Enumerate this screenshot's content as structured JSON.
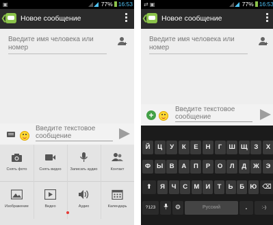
{
  "status": {
    "battery": "77%",
    "time": "16:53"
  },
  "actionbar": {
    "title": "Новое сообщение"
  },
  "recipient": {
    "placeholder": "Введите имя человека или номер"
  },
  "compose": {
    "placeholder": "Введите текстовое сообщение"
  },
  "attachments": [
    {
      "label": "Снять фото",
      "icon": "camera-icon"
    },
    {
      "label": "Снять видео",
      "icon": "video-camera-icon"
    },
    {
      "label": "Записать аудио",
      "icon": "microphone-icon"
    },
    {
      "label": "Контакт",
      "icon": "contact-icon"
    },
    {
      "label": "Изображение",
      "icon": "image-icon"
    },
    {
      "label": "Видео",
      "icon": "video-play-icon"
    },
    {
      "label": "Аудио",
      "icon": "speaker-icon"
    },
    {
      "label": "Календарь",
      "icon": "calendar-icon"
    }
  ],
  "keyboard": {
    "row1": [
      "Й",
      "Ц",
      "У",
      "К",
      "Е",
      "Н",
      "Г",
      "Ш",
      "Щ",
      "З",
      "Х"
    ],
    "row2": [
      "Ф",
      "Ы",
      "В",
      "А",
      "П",
      "Р",
      "О",
      "Л",
      "Д",
      "Ж",
      "Э"
    ],
    "row3": [
      "Я",
      "Ч",
      "С",
      "М",
      "И",
      "Т",
      "Ь",
      "Б",
      "Ю"
    ],
    "symbols_key": "?123",
    "space_label": "Русский",
    "period_key": ".",
    "smiley_key": ":-)"
  },
  "colors": {
    "accent": "#8bc34a",
    "status_time": "#4fc3f7",
    "actionbar": "#2b2b2b"
  }
}
